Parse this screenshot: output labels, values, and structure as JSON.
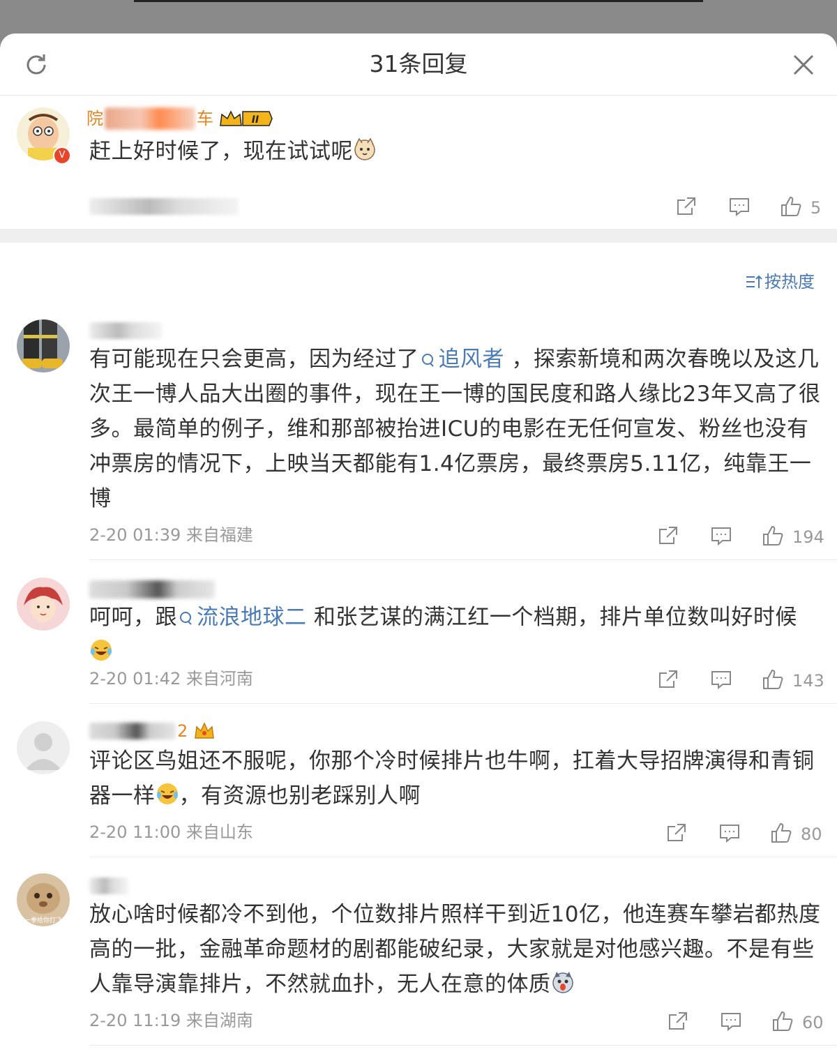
{
  "header": {
    "title": "31条回复",
    "refresh_icon": "refresh-icon",
    "close_icon": "close-icon"
  },
  "root_comment": {
    "username_visible": "院",
    "username_tail": "车",
    "badge_level": "II",
    "text": "赶上好时候了，现在试试呢",
    "likes": "5"
  },
  "sort": {
    "label": "按热度"
  },
  "replies": [
    {
      "text_parts": [
        "有可能现在只会更高，因为经过了",
        "追风者",
        " ，探索新境和两次春晚以及这几次王一博人品大出圈的事件，现在王一博的国民度和路人缘比23年又高了很多。最简单的例子，维和那部被抬进ICU的电影在无任何宣发、粉丝也没有冲票房的情况下，上映当天都能有1.4亿票房，最终票房5.11亿，纯靠王一博"
      ],
      "time": "2-20 01:39",
      "location": "来自福建",
      "likes": "194"
    },
    {
      "text_parts": [
        "呵呵，跟",
        "流浪地球二",
        " 和张艺谋的满江红一个档期，排片单位数叫好时候"
      ],
      "time": "2-20 01:42",
      "location": "来自河南",
      "likes": "143"
    },
    {
      "name_suffix": "2",
      "text_parts": [
        "评论区鸟姐还不服呢，你那个冷时候排片也牛啊，扛着大导招牌演得和青铜器一样",
        "，有资源也别老踩别人啊"
      ],
      "time": "2-20 11:00",
      "location": "来自山东",
      "likes": "80"
    },
    {
      "avatar_caption": "一拳给你打飞",
      "text_parts": [
        "放心啥时候都冷不到他，个位数排片照样干到近10亿，他连赛车攀岩都热度高的一批，金融革命题材的剧都能破纪录，大家就是对他感兴趣。不是有些人靠导演靠排片，不然就血扑，无人在意的体质"
      ],
      "time": "2-20 11:19",
      "location": "来自湖南",
      "likes": "60"
    }
  ],
  "colors": {
    "link": "#4a7bb7",
    "text": "#333333",
    "meta": "#999999",
    "username": "#e7851f"
  }
}
